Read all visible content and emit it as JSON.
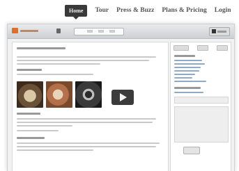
{
  "nav": {
    "items": [
      {
        "label": "Home",
        "active": true
      },
      {
        "label": "Tour",
        "active": false
      },
      {
        "label": "Press & Buzz",
        "active": false
      },
      {
        "label": "Plans & Pricing",
        "active": false
      },
      {
        "label": "Login",
        "active": false
      }
    ]
  },
  "colors": {
    "nav_active_bg": "#3a3a3a",
    "logo_mark": "#e36d24",
    "link_blue": "#8fa9c9",
    "page_bg": "#ffffff",
    "frame_bg": "#f2f2f2"
  },
  "icons": {
    "play": "play-icon",
    "logo": "logo-mark-icon"
  }
}
